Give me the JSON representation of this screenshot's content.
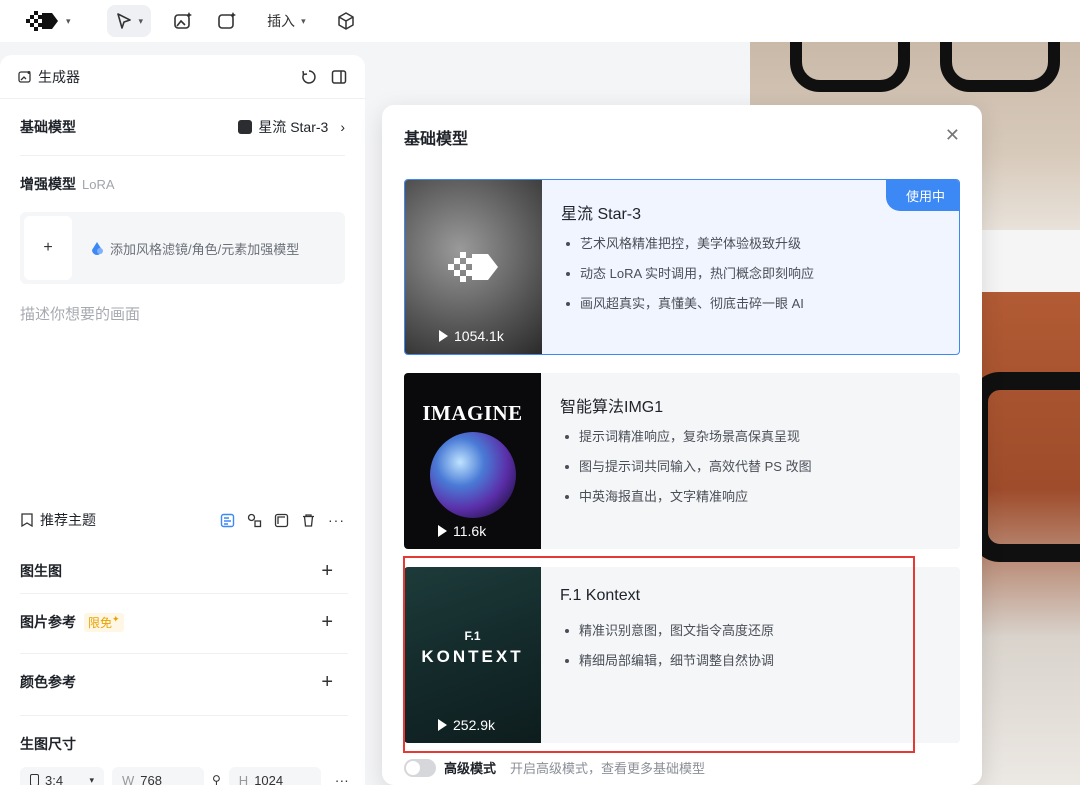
{
  "toolbar": {
    "insert_label": "插入"
  },
  "panel": {
    "title": "生成器",
    "base_model_label": "基础模型",
    "base_model_value": "星流 Star-3",
    "enhance_label": "增强模型",
    "enhance_sub": "LoRA",
    "lora_add_text": "添加风格滤镜/角色/元素加强模型",
    "prompt_placeholder": "描述你想要的画面",
    "theme_label": "推荐主题",
    "img2img_label": "图生图",
    "img_ref_label": "图片参考",
    "free_badge": "限免",
    "color_ref_label": "颜色参考",
    "size_label": "生图尺寸",
    "ratio_value": "3:4",
    "width_prefix": "W",
    "width_value": "768",
    "height_prefix": "H",
    "height_value": "1024"
  },
  "modal": {
    "title": "基础模型",
    "in_use_label": "使用中",
    "models": [
      {
        "name": "星流 Star-3",
        "plays": "1054.1k",
        "features": [
          "艺术风格精准把控，美学体验极致升级",
          "动态 LoRA 实时调用，热门概念即刻响应",
          "画风超真实，真懂美、彻底击碎一眼 AI"
        ]
      },
      {
        "name": "智能算法IMG1",
        "plays": "11.6k",
        "thumb_text": "IMAGINE",
        "features": [
          "提示词精准响应，复杂场景高保真呈现",
          "图与提示词共同输入，高效代替 PS 改图",
          "中英海报直出，文字精准响应"
        ]
      },
      {
        "name": "F.1 Kontext",
        "plays": "252.9k",
        "thumb_text_top": "F.1",
        "thumb_text": "KONTEXT",
        "features": [
          "精准识别意图，图文指令高度还原",
          "精细局部编辑，细节调整自然协调"
        ]
      }
    ],
    "advanced_label": "高级模式",
    "advanced_desc": "开启高级模式，查看更多基础模型"
  },
  "colors": {
    "accent": "#3c88f5",
    "highlight": "#e53935"
  }
}
